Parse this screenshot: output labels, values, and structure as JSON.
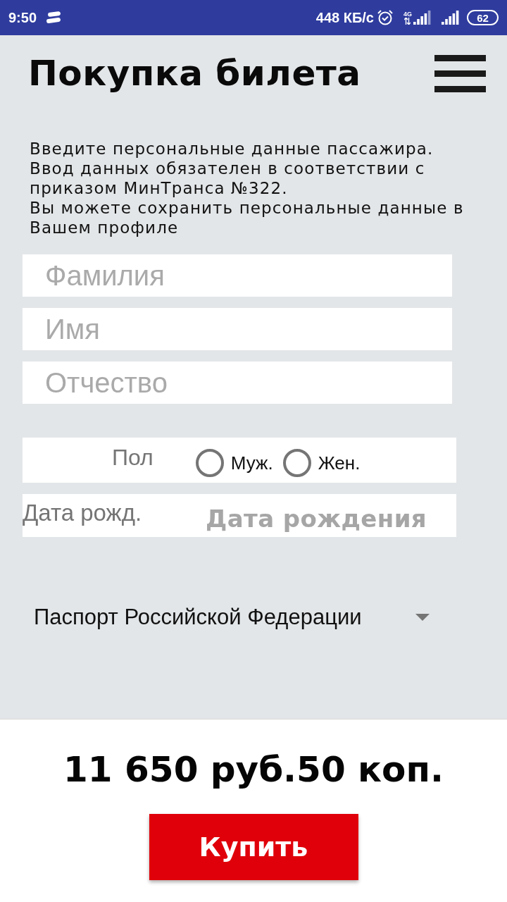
{
  "status_bar": {
    "time": "9:50",
    "speed": "448 КБ/с",
    "network": "4G",
    "battery": "62"
  },
  "header": {
    "title": "Покупка билета"
  },
  "intro": "Введите персональные данные пассажира.\nВвод данных обязателен в соответствии с приказом МинТранса №322.\nВы можете сохранить персональные данные в Вашем профиле",
  "fields": [
    {
      "placeholder": "Фамилия"
    },
    {
      "placeholder": "Имя"
    },
    {
      "placeholder": "Отчество"
    }
  ],
  "gender": {
    "label": "Пол",
    "options": [
      {
        "label": "Муж.",
        "selected": false
      },
      {
        "label": "Жен.",
        "selected": false
      }
    ]
  },
  "birth_date": {
    "label": "Дата рожд.",
    "placeholder": "Дата рождения"
  },
  "document": {
    "value": "Паспорт Российской Федерации"
  },
  "footer": {
    "price": "11 650 руб.50 коп.",
    "button": "Купить"
  }
}
